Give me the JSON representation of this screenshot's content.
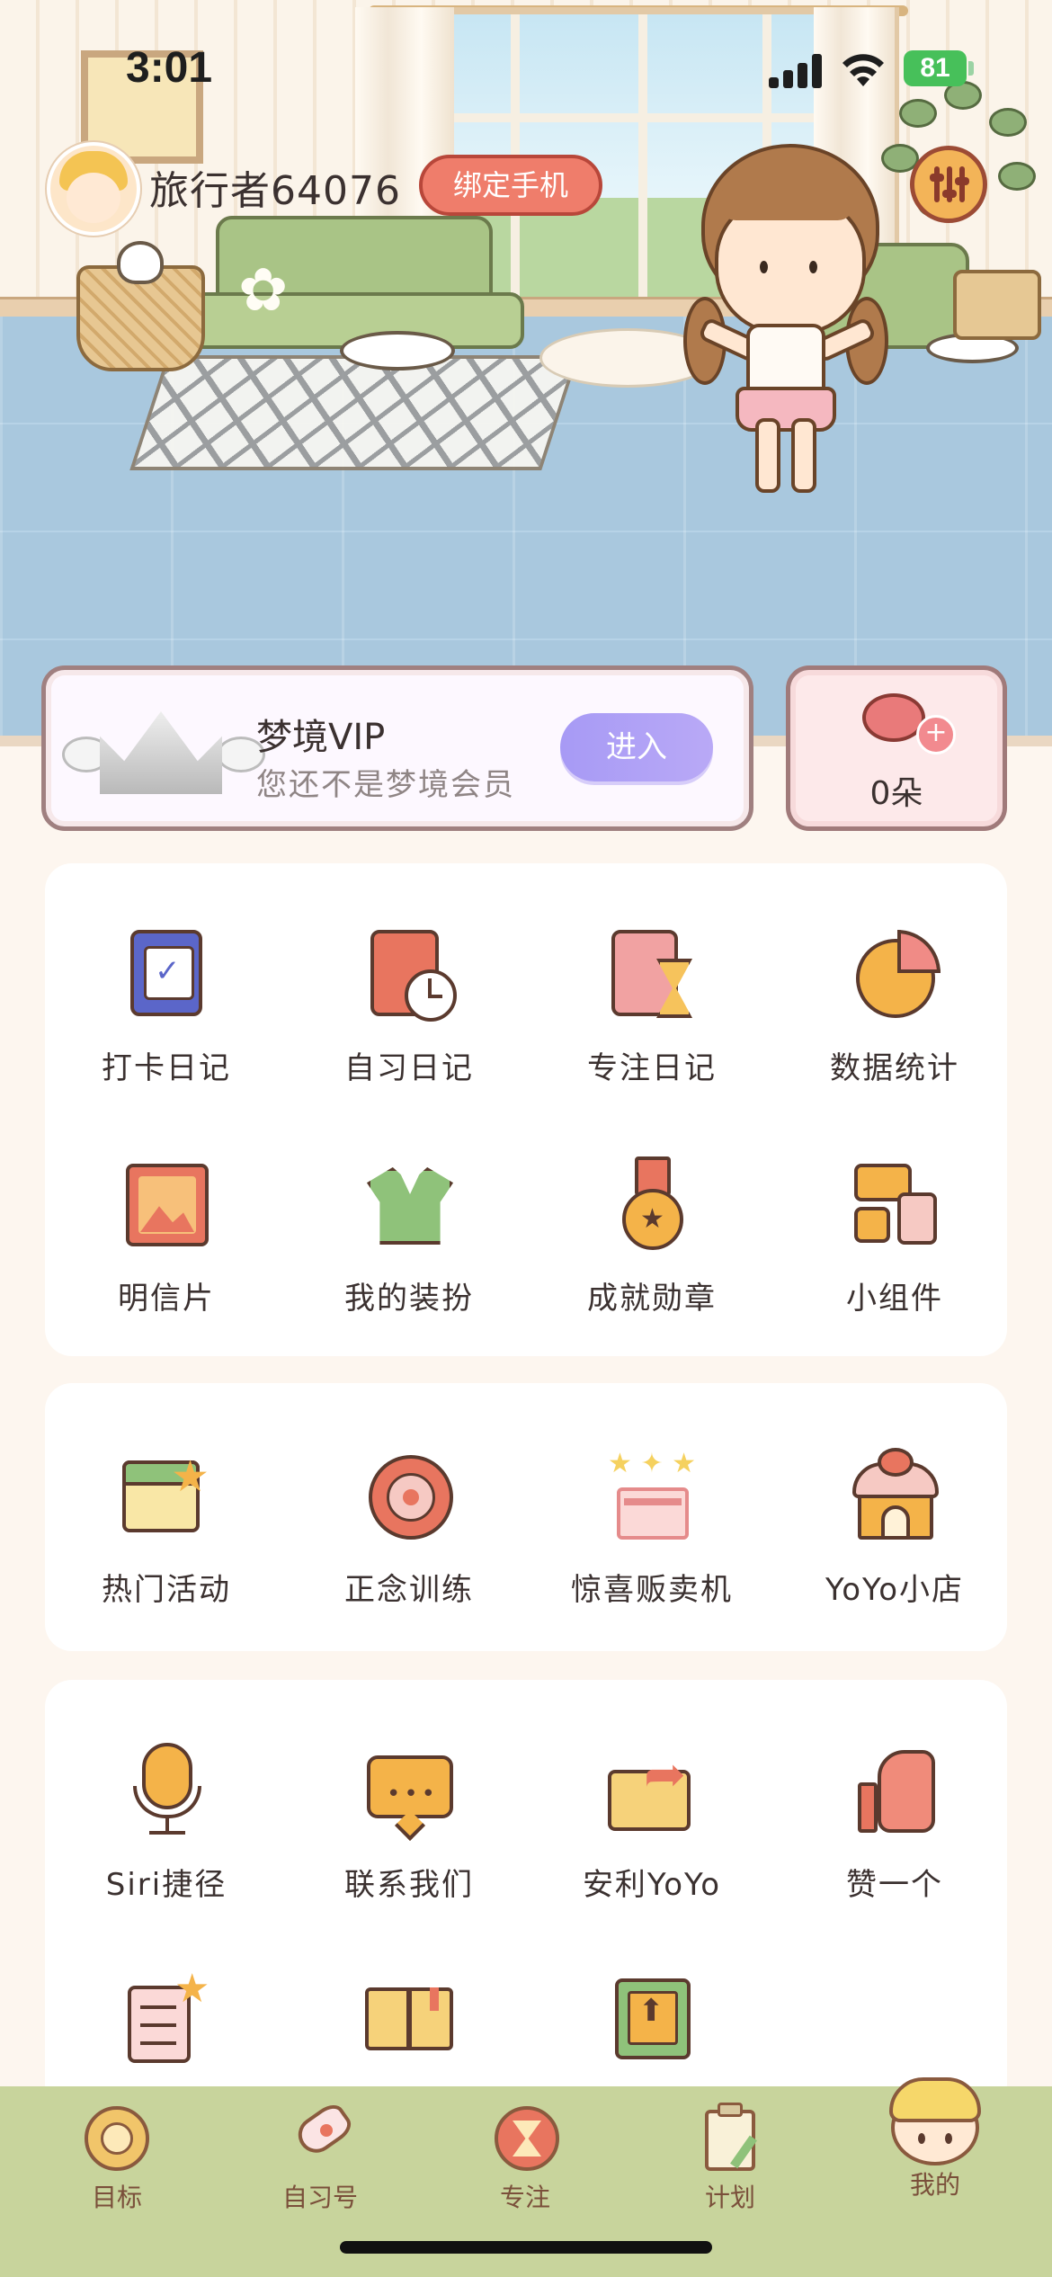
{
  "status_bar": {
    "time": "3:01",
    "battery": "81"
  },
  "header": {
    "username": "旅行者64076",
    "bind_phone_label": "绑定手机"
  },
  "vip": {
    "title": "梦境VIP",
    "subtitle": "您还不是梦境会员",
    "enter_label": "进入"
  },
  "flowers": {
    "count": "0朵"
  },
  "panel1": {
    "items": [
      {
        "label": "打卡日记",
        "icon": "checkin-diary-icon"
      },
      {
        "label": "自习日记",
        "icon": "study-diary-icon"
      },
      {
        "label": "专注日记",
        "icon": "focus-diary-icon"
      },
      {
        "label": "数据统计",
        "icon": "pie-chart-icon"
      },
      {
        "label": "明信片",
        "icon": "postcard-icon"
      },
      {
        "label": "我的装扮",
        "icon": "outfit-icon"
      },
      {
        "label": "成就勋章",
        "icon": "medal-icon"
      },
      {
        "label": "小组件",
        "icon": "widget-icon"
      }
    ]
  },
  "panel2": {
    "items": [
      {
        "label": "热门活动",
        "icon": "calendar-star-icon"
      },
      {
        "label": "正念训练",
        "icon": "mandala-icon"
      },
      {
        "label": "惊喜贩卖机",
        "icon": "gift-box-icon"
      },
      {
        "label": "YoYo小店",
        "icon": "shop-icon"
      }
    ]
  },
  "panel3": {
    "items": [
      {
        "label": "Siri捷径",
        "icon": "microphone-icon"
      },
      {
        "label": "联系我们",
        "icon": "chat-bubble-icon"
      },
      {
        "label": "安利YoYo",
        "icon": "share-folder-icon"
      },
      {
        "label": "赞一个",
        "icon": "thumbs-up-icon"
      },
      {
        "label": "",
        "icon": "checklist-wand-icon"
      },
      {
        "label": "",
        "icon": "open-book-icon"
      },
      {
        "label": "",
        "icon": "upload-icon"
      }
    ]
  },
  "tabbar": {
    "items": [
      {
        "label": "目标",
        "icon": "target-icon"
      },
      {
        "label": "自习号",
        "icon": "rocket-icon"
      },
      {
        "label": "专注",
        "icon": "hourglass-icon"
      },
      {
        "label": "计划",
        "icon": "clipboard-icon"
      },
      {
        "label": "我的",
        "icon": "avatar-icon"
      }
    ]
  }
}
